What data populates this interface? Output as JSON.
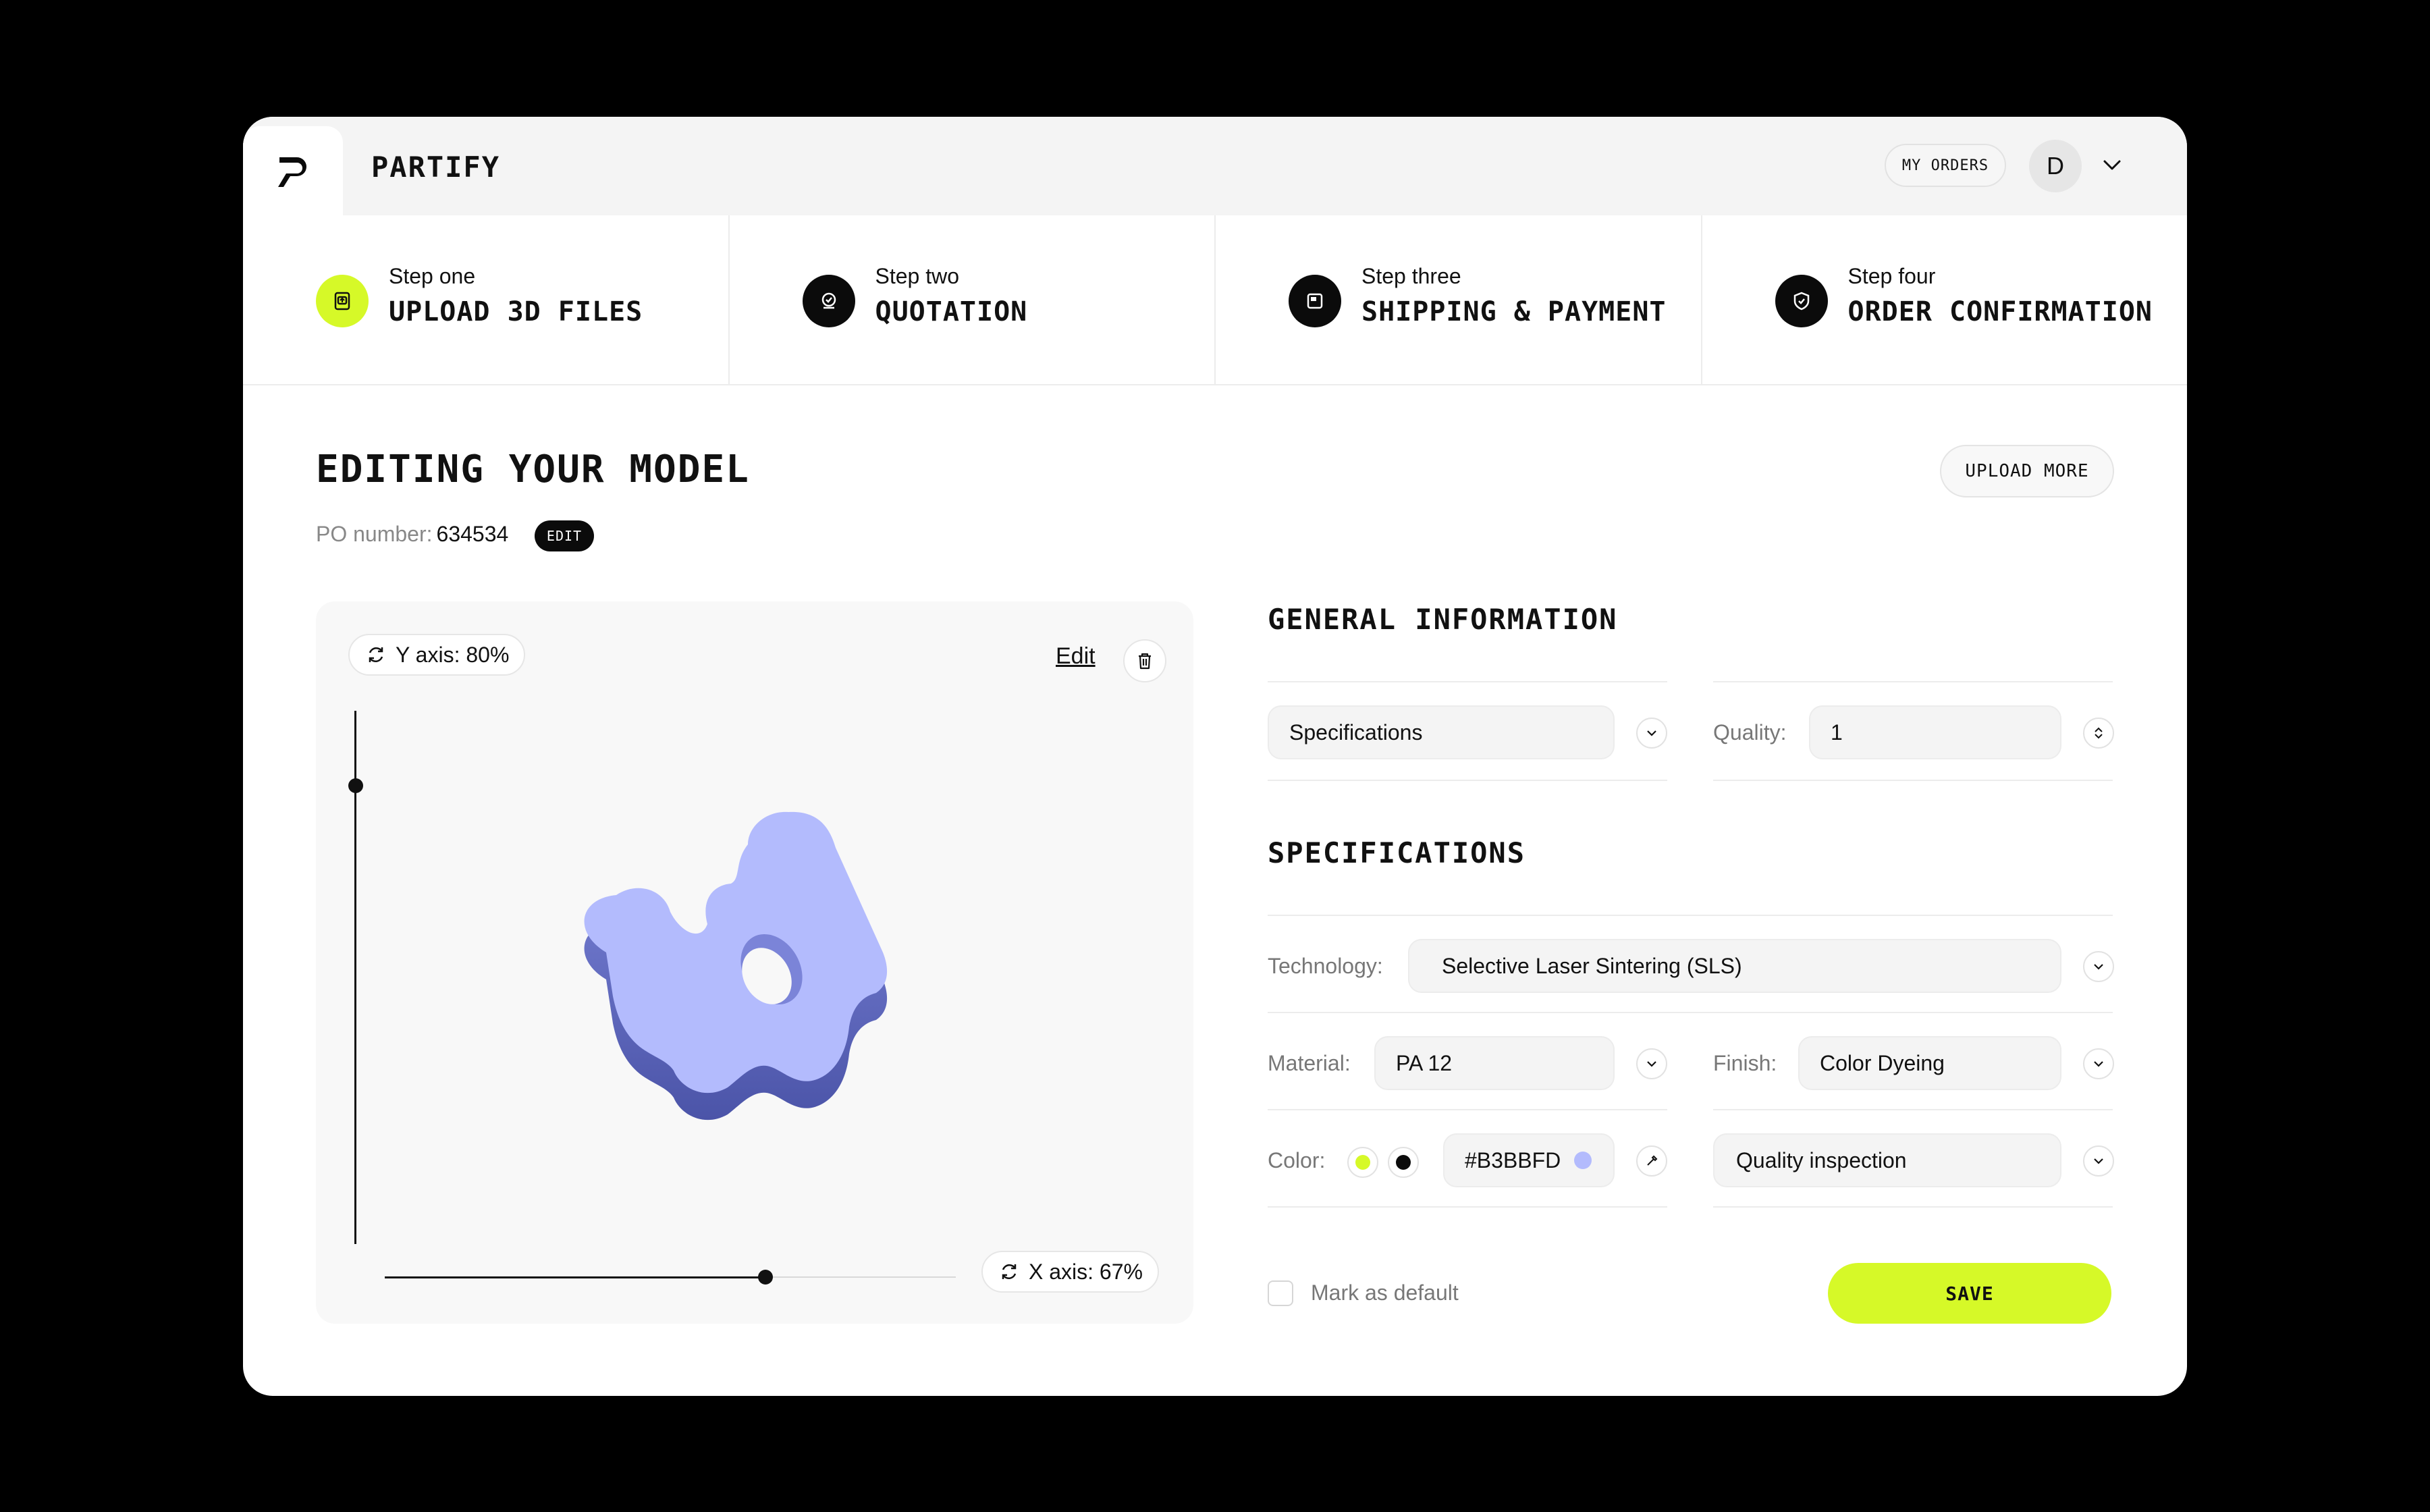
{
  "app": {
    "brand": "PARTIFY"
  },
  "header": {
    "my_orders": "MY ORDERS",
    "avatar_initial": "D"
  },
  "steps": [
    {
      "sub": "Step one",
      "title": "UPLOAD 3D FILES",
      "active": true
    },
    {
      "sub": "Step two",
      "title": "QUOTATION",
      "active": false
    },
    {
      "sub": "Step three",
      "title": "SHIPPING & PAYMENT",
      "active": false
    },
    {
      "sub": "Step four",
      "title": "ORDER CONFIRMATION",
      "active": false
    }
  ],
  "page": {
    "title": "EDITING YOUR MODEL",
    "po_label": "PO number:",
    "po_value": "634534",
    "po_edit": "EDIT",
    "upload_more": "UPLOAD MORE"
  },
  "viewer": {
    "y_axis": "Y axis: 80%",
    "x_axis": "X axis: 67%",
    "y_axis_level": 0.8,
    "x_axis_level": 0.67,
    "edit": "Edit",
    "model_color": "#B3BBFD"
  },
  "general": {
    "title": "GENERAL INFORMATION",
    "specifications_select": "Specifications",
    "quality_label": "Quality:",
    "quality_value": "1"
  },
  "specifications": {
    "title": "SPECIFICATIONS",
    "technology_label": "Technology:",
    "technology_value": "Selective Laser Sintering (SLS)",
    "material_label": "Material:",
    "material_value": "PA 12",
    "finish_label": "Finish:",
    "finish_value": "Color Dyeing",
    "color_label": "Color:",
    "color_hex": "#B3BBFD",
    "color_swatches": [
      "#d6f928",
      "#0b0b0b"
    ],
    "inspection_value": "Quality inspection"
  },
  "footer": {
    "mark_default": "Mark as default",
    "save": "SAVE"
  },
  "colors": {
    "accent": "#d6f928",
    "dark": "#0b0b0b",
    "model": "#B3BBFD"
  }
}
